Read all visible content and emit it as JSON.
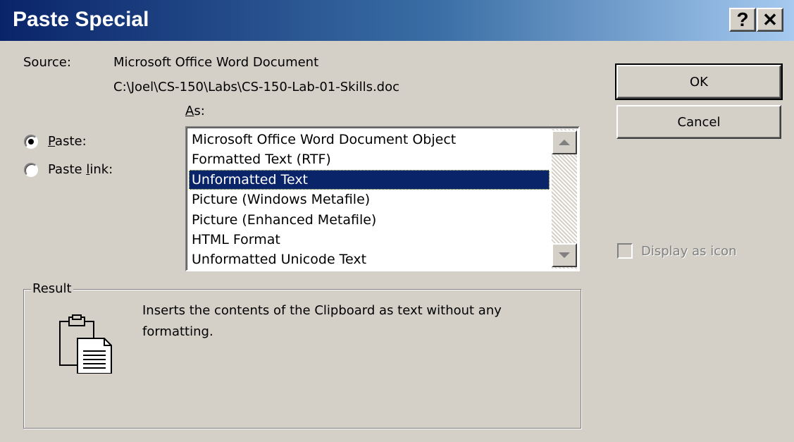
{
  "window": {
    "title": "Paste Special",
    "help_glyph": "?",
    "close_glyph": "✕"
  },
  "source": {
    "label": "Source:",
    "name": "Microsoft Office Word Document",
    "path": "C:\\Joel\\CS-150\\Labs\\CS-150-Lab-01-Skills.doc"
  },
  "as_label": {
    "mnemonic": "A",
    "rest": "s:"
  },
  "options": {
    "paste": {
      "mnemonic": "P",
      "rest": "aste:",
      "selected": true
    },
    "paste_link": {
      "before": "Paste ",
      "mnemonic": "l",
      "rest": "ink:",
      "selected": false
    }
  },
  "list": {
    "items": [
      "Microsoft Office Word Document Object",
      "Formatted Text (RTF)",
      "Unformatted Text",
      "Picture (Windows Metafile)",
      "Picture (Enhanced Metafile)",
      "HTML Format",
      "Unformatted Unicode Text"
    ],
    "selected_index": 2
  },
  "buttons": {
    "ok": "OK",
    "cancel": "Cancel"
  },
  "display_as_icon": {
    "label": "Display as icon",
    "checked": false,
    "enabled": false
  },
  "result": {
    "label": "Result",
    "text": "Inserts the contents of the Clipboard as text without any formatting."
  },
  "icons": {
    "help": "help-icon",
    "close": "close-icon",
    "result": "clipboard-paste-icon"
  },
  "colors": {
    "dialog_bg": "#d4d0c8",
    "title_start": "#0a246a",
    "title_end": "#a6caf0",
    "selection_bg": "#0a246a"
  }
}
